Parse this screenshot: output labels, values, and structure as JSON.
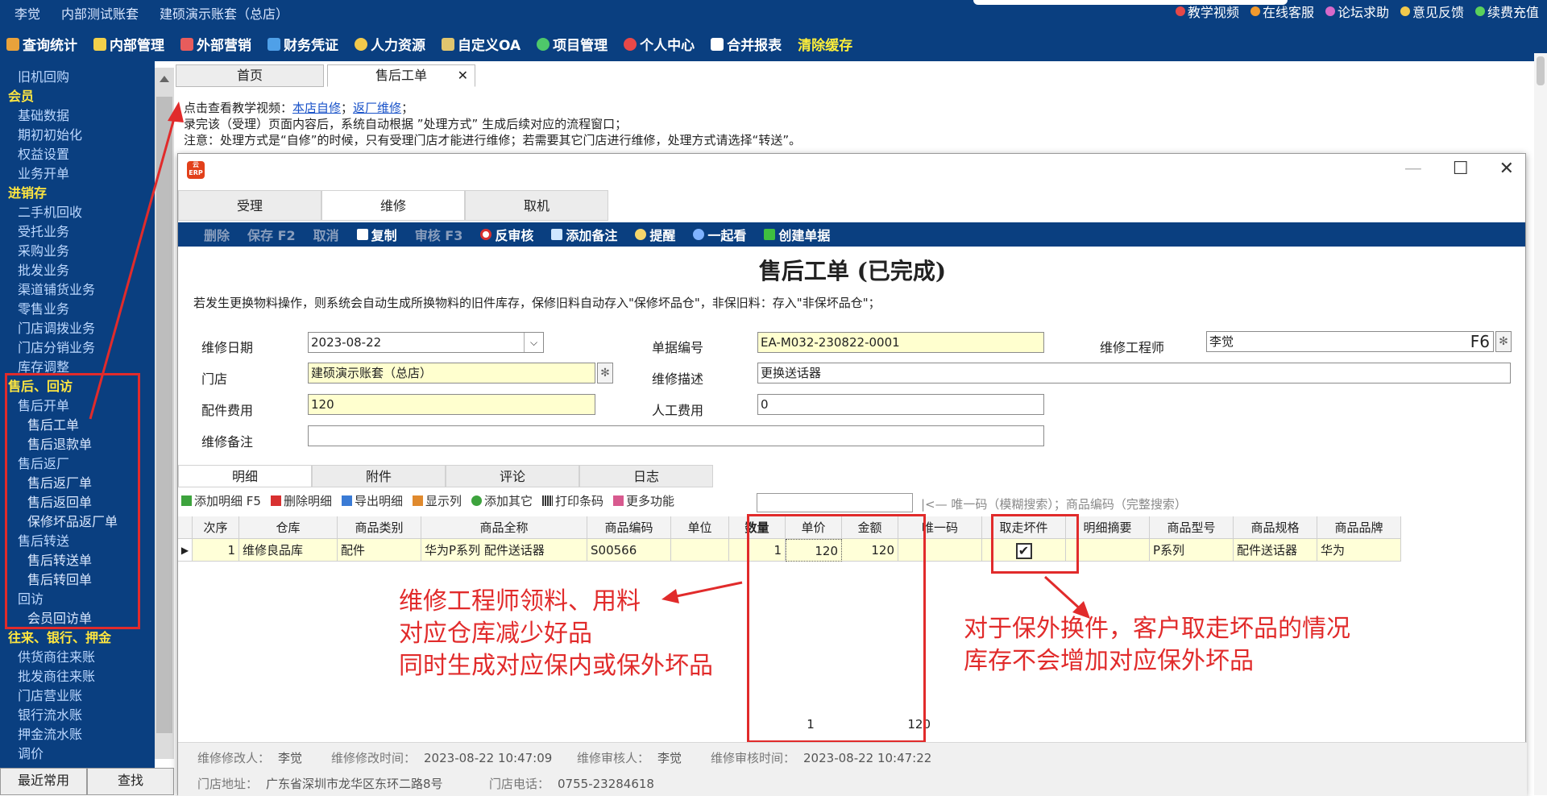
{
  "header": {
    "user": "李觉",
    "account_type": "内部测试账套",
    "account_name": "建硕演示账套（总店）",
    "top_links": [
      {
        "label": "教学视频",
        "icon": "play-icon",
        "color": "#e64848"
      },
      {
        "label": "在线客服",
        "icon": "person-icon",
        "color": "#f29a2e"
      },
      {
        "label": "论坛求助",
        "icon": "forum-icon",
        "color": "#d869c9"
      },
      {
        "label": "意见反馈",
        "icon": "pencil-icon",
        "color": "#f2c94c"
      },
      {
        "label": "续费充值",
        "icon": "wechat-icon",
        "color": "#5bd15b"
      }
    ],
    "menu": [
      {
        "label": "查询统计",
        "color": "#e9a23b"
      },
      {
        "label": "内部管理",
        "color": "#f2d04b"
      },
      {
        "label": "外部营销",
        "color": "#e85c5c"
      },
      {
        "label": "财务凭证",
        "color": "#4fa0e8"
      },
      {
        "label": "人力资源",
        "color": "#f2c94c"
      },
      {
        "label": "自定义OA",
        "color": "#e0c56e"
      },
      {
        "label": "项目管理",
        "color": "#4ec86a"
      },
      {
        "label": "个人中心",
        "color": "#e84848"
      },
      {
        "label": "合并报表",
        "color": "#ffffff"
      }
    ],
    "clear_cache": "清除缓存"
  },
  "sidebar": {
    "items": [
      {
        "label": "旧机回购",
        "level": "l1"
      },
      {
        "label": "会员",
        "level": "g"
      },
      {
        "label": "基础数据",
        "level": "l1"
      },
      {
        "label": "期初初始化",
        "level": "l1"
      },
      {
        "label": "权益设置",
        "level": "l1"
      },
      {
        "label": "业务开单",
        "level": "l1"
      },
      {
        "label": "进销存",
        "level": "g"
      },
      {
        "label": "二手机回收",
        "level": "l1"
      },
      {
        "label": "受托业务",
        "level": "l1"
      },
      {
        "label": "采购业务",
        "level": "l1"
      },
      {
        "label": "批发业务",
        "level": "l1"
      },
      {
        "label": "渠道铺货业务",
        "level": "l1"
      },
      {
        "label": "零售业务",
        "level": "l1"
      },
      {
        "label": "门店调拨业务",
        "level": "l1"
      },
      {
        "label": "门店分销业务",
        "level": "l1"
      },
      {
        "label": "库存调整",
        "level": "l1"
      },
      {
        "label": "售后、回访",
        "level": "g"
      },
      {
        "label": "售后开单",
        "level": "l1"
      },
      {
        "label": "售后工单",
        "level": "l2"
      },
      {
        "label": "售后退款单",
        "level": "l2"
      },
      {
        "label": "售后返厂",
        "level": "l1"
      },
      {
        "label": "售后返厂单",
        "level": "l2"
      },
      {
        "label": "售后返回单",
        "level": "l2"
      },
      {
        "label": "保修坏品返厂单",
        "level": "l2"
      },
      {
        "label": "售后转送",
        "level": "l1"
      },
      {
        "label": "售后转送单",
        "level": "l2"
      },
      {
        "label": "售后转回单",
        "level": "l2"
      },
      {
        "label": "回访",
        "level": "l1"
      },
      {
        "label": "会员回访单",
        "level": "l2"
      },
      {
        "label": "往来、银行、押金",
        "level": "g"
      },
      {
        "label": "供货商往来账",
        "level": "l1"
      },
      {
        "label": "批发商往来账",
        "level": "l1"
      },
      {
        "label": "门店营业账",
        "level": "l1"
      },
      {
        "label": "银行流水账",
        "level": "l1"
      },
      {
        "label": "押金流水账",
        "level": "l1"
      },
      {
        "label": "调价",
        "level": "l1"
      }
    ],
    "btn_recent": "最近常用",
    "btn_search": "查找"
  },
  "main_tabs": {
    "home": "首页",
    "current": "售后工单",
    "close": "✕"
  },
  "intro": {
    "line1_prefix": "点击查看教学视频：",
    "link1": "本店自修",
    "sep": "；",
    "link2": "返厂维修",
    "line1_suffix": "；",
    "line2": "录完该（受理）页面内容后，系统自动根据 ”处理方式” 生成后续对应的流程窗口；",
    "line3": "注意：处理方式是“自修”的时候，只有受理门店才能进行维修；若需要其它门店进行维修，处理方式请选择“转送”。"
  },
  "dialog": {
    "logo": "云ERP",
    "tabs": [
      "受理",
      "维修",
      "取机"
    ],
    "toolbar": [
      {
        "label": "删除",
        "enabled": false
      },
      {
        "label": "保存 F2",
        "enabled": false
      },
      {
        "label": "取消",
        "enabled": false
      },
      {
        "label": "复制",
        "enabled": true,
        "icon": "copy-icon"
      },
      {
        "label": "审核 F3",
        "enabled": false
      },
      {
        "label": "反审核",
        "enabled": true,
        "icon": "x-circle-icon"
      },
      {
        "label": "添加备注",
        "enabled": true,
        "icon": "note-icon"
      },
      {
        "label": "提醒",
        "enabled": true,
        "icon": "clock-icon"
      },
      {
        "label": "一起看",
        "enabled": true,
        "icon": "people-icon"
      },
      {
        "label": "创建单据",
        "enabled": true,
        "icon": "plus-icon"
      }
    ],
    "form_title": "售后工单 (已完成)",
    "notice": "若发生更换物料操作，则系统会自动生成所换物料的旧件库存，保修旧料自动存入\"保修坏品仓\"，非保旧料：存入\"非保坏品仓\"；",
    "fields": {
      "repair_date_label": "维修日期",
      "repair_date": "2023-08-22",
      "doc_no_label": "单据编号",
      "doc_no": "EA-M032-230822-0001",
      "engineer_label": "维修工程师",
      "engineer": "李觉",
      "engineer_key": "F6",
      "store_label": "门店",
      "store": "建硕演示账套（总店）",
      "desc_label": "维修描述",
      "desc": "更换送话器",
      "parts_fee_label": "配件费用",
      "parts_fee": "120",
      "labor_fee_label": "人工费用",
      "labor_fee": "0",
      "remark_label": "维修备注",
      "remark": ""
    },
    "detail_tabs": [
      "明细",
      "附件",
      "评论",
      "日志"
    ],
    "detail_toolbar": [
      {
        "label": "添加明细 F5",
        "icon": "plus-icon",
        "color": "#3da33d"
      },
      {
        "label": "删除明细",
        "icon": "x-icon",
        "color": "#d83030"
      },
      {
        "label": "导出明细",
        "icon": "export-icon",
        "color": "#3a7bd5"
      },
      {
        "label": "显示列",
        "icon": "columns-icon",
        "color": "#e08a2e"
      },
      {
        "label": "添加其它",
        "icon": "plus-circle-icon",
        "color": "#3da33d"
      },
      {
        "label": "打印条码",
        "icon": "barcode-icon",
        "color": "#333333"
      },
      {
        "label": "更多功能",
        "icon": "grid-icon",
        "color": "#d85a8f"
      }
    ],
    "search_hint": "|<— 唯一码（模糊搜索）；商品编码（完整搜索）",
    "grid": {
      "headers": [
        "次序",
        "仓库",
        "商品类别",
        "商品全称",
        "商品编码",
        "单位",
        "数量",
        "单价",
        "金额",
        "唯一码",
        "取走坏件",
        "明细摘要",
        "商品型号",
        "商品规格",
        "商品品牌"
      ],
      "row": {
        "seq": "1",
        "warehouse": "维修良品库",
        "category": "配件",
        "name": "华为P系列 配件送话器",
        "code": "S00566",
        "unit": "",
        "qty": "1",
        "price": "120",
        "amount": "120",
        "unique": "",
        "take_bad": "✔",
        "summary": "",
        "model": "P系列",
        "spec": "配件送话器",
        "brand": "华为"
      },
      "total_qty": "1",
      "total_amount": "120"
    },
    "footer": {
      "modifier_label": "维修修改人：",
      "modifier": "李觉",
      "modify_time_label": "维修修改时间：",
      "modify_time": "2023-08-22 10:47:09",
      "auditor_label": "维修审核人：",
      "auditor": "李觉",
      "audit_time_label": "维修审核时间：",
      "audit_time": "2023-08-22 10:47:22",
      "addr_label": "门店地址：",
      "addr": "广东省深圳市龙华区东环二路8号",
      "phone_label": "门店电话：",
      "phone": "0755-23284618"
    }
  },
  "annotations": {
    "note1": [
      "维修工程师领料、用料",
      "对应仓库减少好品",
      "同时生成对应保内或保外坏品"
    ],
    "note2": [
      "对于保外换件，客户取走坏品的情况",
      "库存不会增加对应保外坏品"
    ],
    "color": "#e12b2b"
  }
}
